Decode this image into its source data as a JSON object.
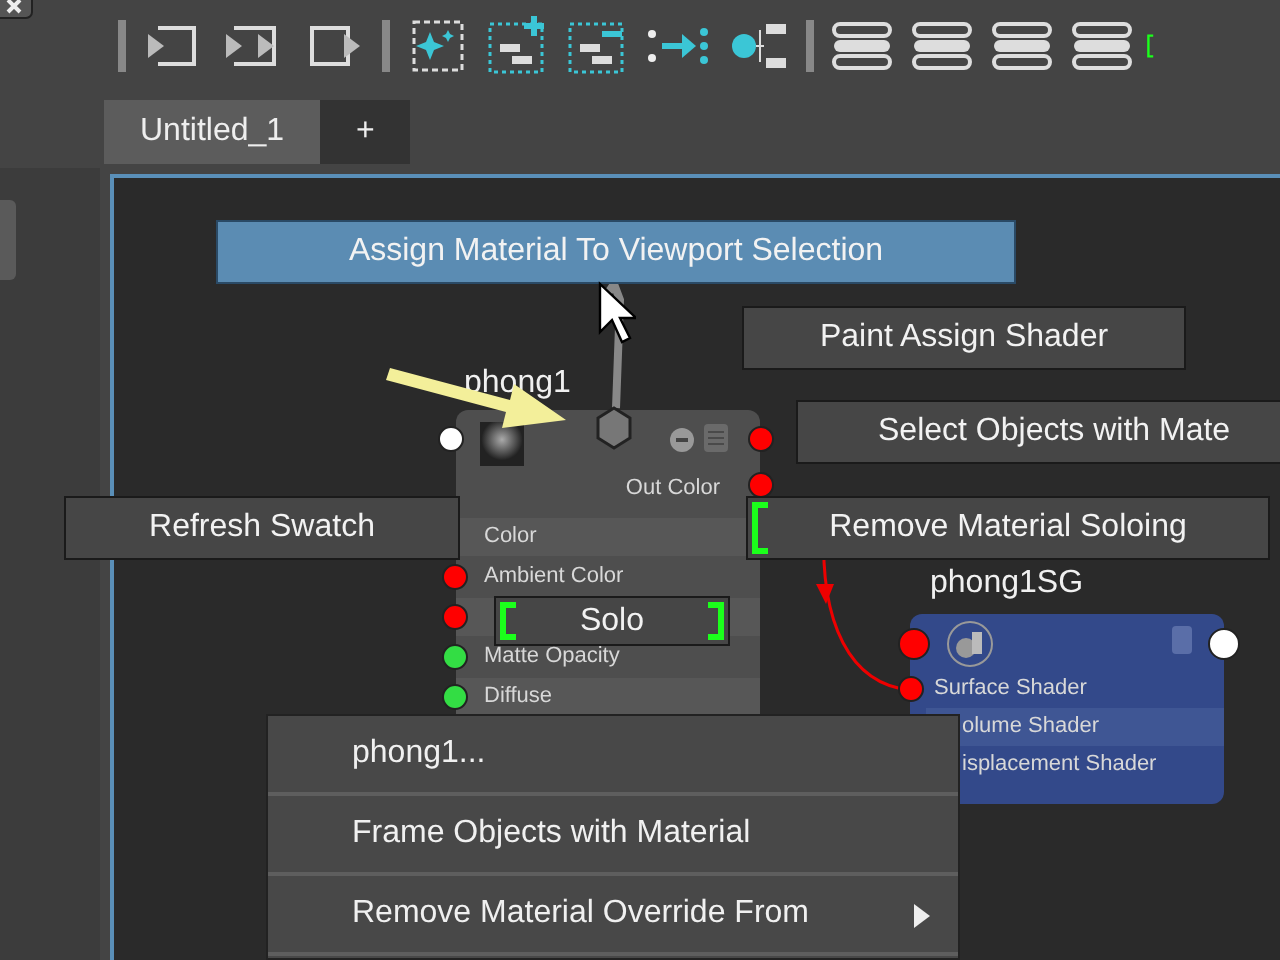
{
  "tabs": [
    {
      "label": "Untitled_1",
      "selected": true
    },
    {
      "label": "+",
      "selected": false
    }
  ],
  "marking_menu": [
    {
      "label": "Assign Material To Viewport Selection",
      "selected": true,
      "bracket_left": false,
      "bracket_right": false
    },
    {
      "label": "Paint Assign Shader",
      "selected": false,
      "bracket_left": false,
      "bracket_right": false
    },
    {
      "label": "Select Objects with Mate",
      "selected": false,
      "bracket_left": false,
      "bracket_right": false
    },
    {
      "label": "Refresh Swatch",
      "selected": false,
      "bracket_left": false,
      "bracket_right": false
    },
    {
      "label": "Remove Material Soloing",
      "selected": false,
      "bracket_left": true,
      "bracket_right": false
    },
    {
      "label": "Solo",
      "selected": false,
      "bracket_left": true,
      "bracket_right": true
    }
  ],
  "nodes": [
    {
      "name": "phong1",
      "output": "Out Color",
      "attributes": [
        {
          "label": "Color"
        },
        {
          "label": "Ambient Color",
          "color": "#ff0000"
        },
        {
          "color": "#ff0000"
        },
        {
          "label": "Matte Opacity",
          "color": "#33dd44"
        },
        {
          "label": "Diffuse",
          "color": "#33dd44"
        }
      ]
    },
    {
      "name": "phong1SG",
      "attributes": [
        {
          "label": "Surface Shader",
          "color": "#ff0000"
        },
        {
          "label": "olume Shader"
        },
        {
          "label": "isplacement Shader"
        }
      ]
    }
  ],
  "context_menu": [
    {
      "label": "phong1...",
      "submenu": false
    },
    {
      "label": "Frame Objects with Material",
      "submenu": false
    },
    {
      "label": "Remove Material Override From",
      "submenu": true
    }
  ]
}
